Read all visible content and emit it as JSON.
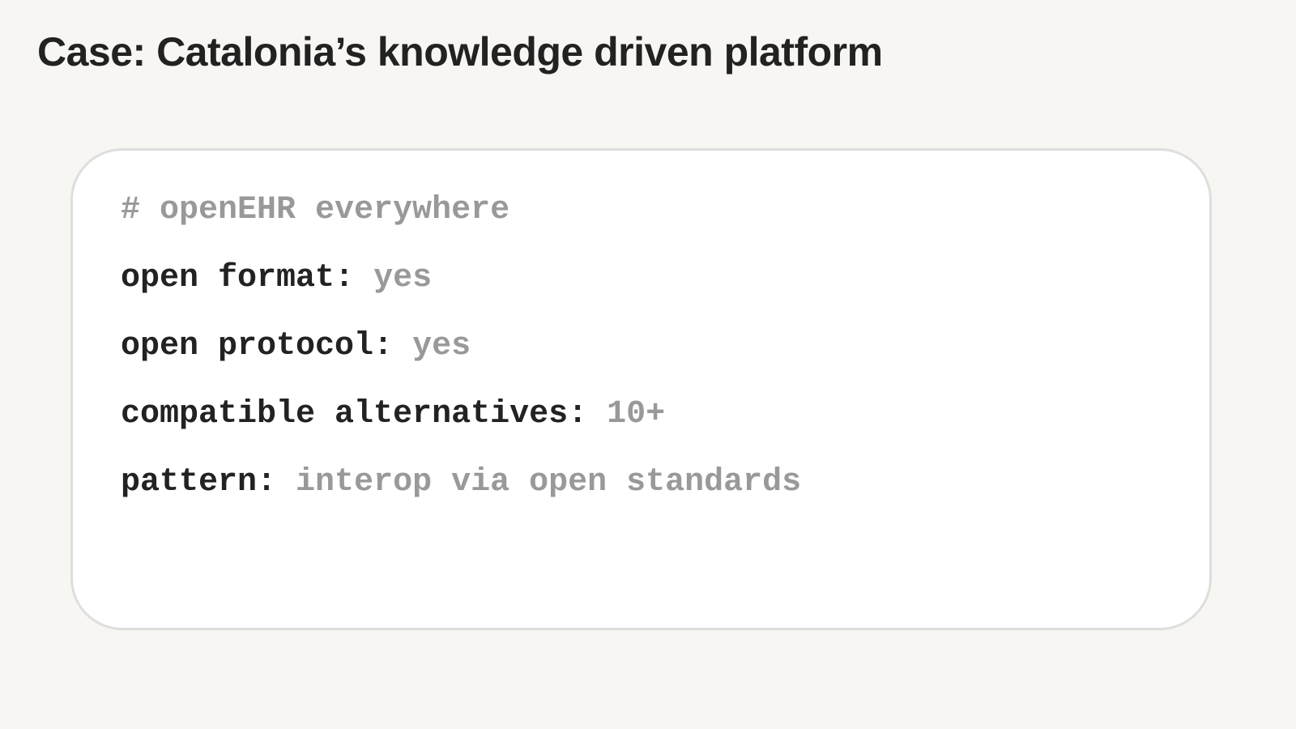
{
  "page": {
    "title": "Case: Catalonia’s knowledge driven platform"
  },
  "code_block": {
    "comment": "# openEHR everywhere",
    "rows": [
      {
        "key": "open format:",
        "value": "yes"
      },
      {
        "key": "open protocol:",
        "value": "yes"
      },
      {
        "key": "compatible alternatives:",
        "value": "10+"
      },
      {
        "key": "pattern:",
        "value": "interop via open standards"
      }
    ]
  },
  "colors": {
    "background": "#f8f6f2",
    "card": "#ffffff",
    "card_border": "#dedede",
    "key_text": "#222222",
    "value_text": "#999999"
  }
}
